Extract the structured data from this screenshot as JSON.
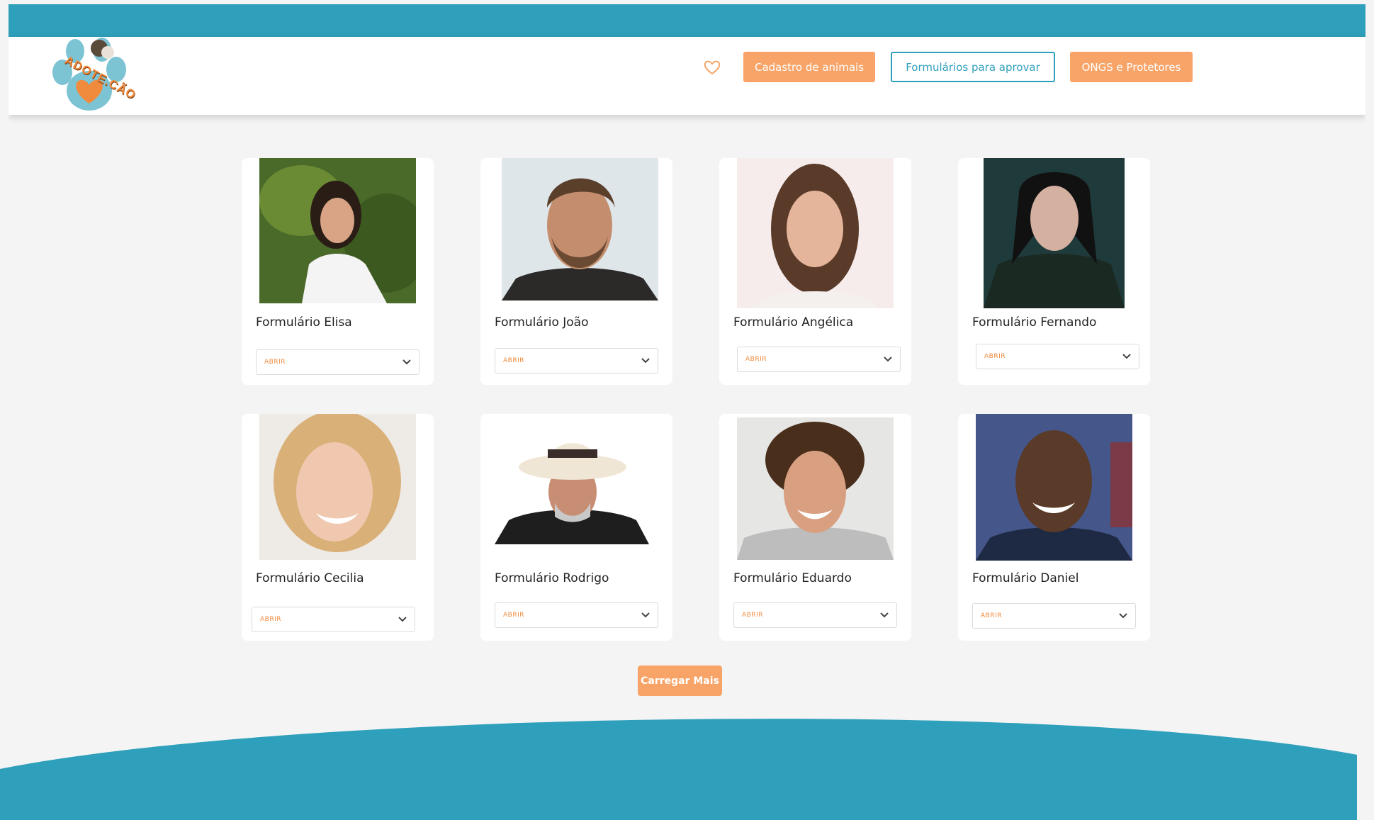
{
  "brand": {
    "logo_text": "ADOTE.CÃO",
    "accent": "#2fa0bb",
    "orange": "#f8a468"
  },
  "nav": {
    "favorites_icon": "heart-icon",
    "buttons": [
      {
        "label": "Cadastro de animais",
        "style": "filled"
      },
      {
        "label": "Formulários para aprovar",
        "style": "outline"
      },
      {
        "label": "ONGS e Protetores",
        "style": "filled"
      }
    ]
  },
  "cards": [
    {
      "title": "Formulário Elisa",
      "select": "ABRIR"
    },
    {
      "title": "Formulário João",
      "select": "ABRIR"
    },
    {
      "title": "Formulário Angélica",
      "select": "ABRIR"
    },
    {
      "title": "Formulário Fernando",
      "select": "ABRIR"
    },
    {
      "title": "Formulário Cecilia",
      "select": "ABRIR"
    },
    {
      "title": "Formulário Rodrigo",
      "select": "ABRIR"
    },
    {
      "title": "Formulário Eduardo",
      "select": "ABRIR"
    },
    {
      "title": "Formulário Daniel",
      "select": "ABRIR"
    }
  ],
  "load_more": "Carregar Mais"
}
